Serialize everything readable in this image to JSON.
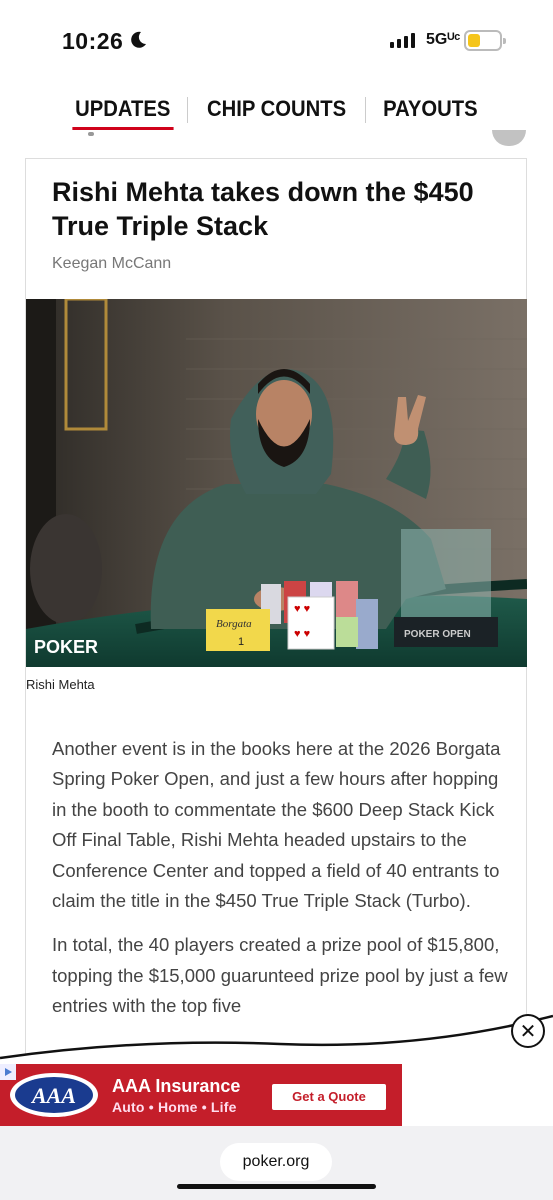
{
  "status": {
    "time": "10:26",
    "network": "5Gᵁᶜ"
  },
  "tabs": [
    {
      "label": "UPDATES",
      "active": true
    },
    {
      "label": "CHIP COUNTS",
      "active": false
    },
    {
      "label": "PAYOUTS",
      "active": false
    }
  ],
  "article": {
    "headline": "Rishi Mehta takes down the $450 True Triple Stack",
    "author": "Keegan McCann",
    "photo_caption": "Rishi Mehta",
    "photo_watermark": "POKER",
    "paragraphs": [
      "Another event is in the books here at the 2026 Borgata Spring Poker Open, and just a few hours after hopping in the booth to commentate the $600 Deep Stack Kick Off Final Table, Rishi Mehta headed upstairs to the Conference Center and topped a field of 40 entrants to claim the title in the $450 True Triple Stack (Turbo).",
      "In total, the 40 players created a prize pool of $15,800, topping the $15,000 guarunteed prize pool by just a few entries with the top five"
    ]
  },
  "ad": {
    "brand": "AAA",
    "title": "AAA Insurance",
    "subtitle": "Auto • Home • Life",
    "cta": "Get a Quote",
    "close_icon": "close-icon"
  },
  "browser": {
    "url": "poker.org"
  },
  "colors": {
    "accent": "#d0021b",
    "ad_red": "#c41e2a"
  }
}
